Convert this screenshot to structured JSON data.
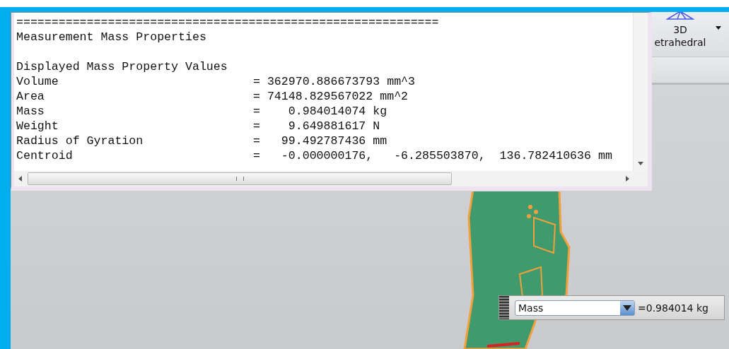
{
  "info_window": {
    "rule": "============================================================",
    "title": "Measurement Mass Properties",
    "section": "Displayed Mass Property Values",
    "properties": [
      {
        "label": "Volume",
        "value": "= 362970.886673793 mm^3"
      },
      {
        "label": "Area",
        "value": "= 74148.829567022 mm^2"
      },
      {
        "label": "Mass",
        "value": "=    0.984014074 kg"
      },
      {
        "label": "Weight",
        "value": "=    9.649881617 N"
      },
      {
        "label": "Radius of Gyration",
        "value": "=   99.492787436 mm"
      },
      {
        "label": "Centroid",
        "value": "=   -0.000000176,   -6.285503870,  136.782410636 mm"
      }
    ]
  },
  "ribbon": {
    "button": {
      "label_lines": [
        "3D",
        "etrahedral"
      ]
    }
  },
  "measure_toolbar": {
    "select": {
      "value": "Mass"
    },
    "result": "=0.984014 kg"
  }
}
